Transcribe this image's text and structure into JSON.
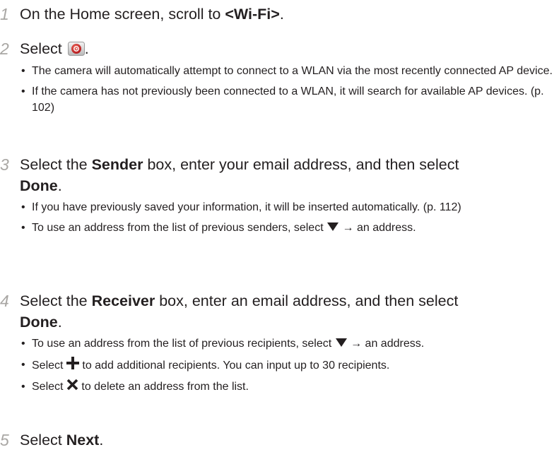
{
  "steps": [
    {
      "num": "1",
      "pre": "On the Home screen, scroll to ",
      "bold": "<Wi-Fi>",
      "post": "."
    },
    {
      "num": "2",
      "pre": "Select ",
      "icon": "email-app-icon",
      "post": ".",
      "bullets": [
        "The camera will automatically attempt to connect to a WLAN via the most recently connected AP device.",
        "If the camera has not previously been connected to a WLAN, it will search for available AP devices. (p. 102)"
      ]
    },
    {
      "num": "3",
      "pre": "Select the ",
      "bold": "Sender",
      "mid": " box, enter your email address, and then select",
      "bold2": "Done",
      "post": ".",
      "bullets": [
        "If you have previously saved your information, it will be inserted automatically. (p. 112)"
      ],
      "bullet_with_glyph": {
        "pre": "To use an address from the list of previous senders, select ",
        "glyph": "dropdown-triangle-icon",
        "post": " → an address."
      }
    },
    {
      "num": "4",
      "pre": "Select the ",
      "bold": "Receiver",
      "mid": " box, enter an email address, and then select",
      "bold2": "Done",
      "post": ".",
      "bullet_triangle": {
        "pre": "To use an address from the list of previous recipients, select ",
        "glyph": "dropdown-triangle-icon",
        "post": " → an address."
      },
      "bullet_plus": {
        "pre": "Select ",
        "glyph": "plus-icon",
        "post": " to add additional recipients. You can input up to 30 recipients."
      },
      "bullet_x": {
        "pre": "Select ",
        "glyph": "close-x-icon",
        "post": " to delete an address from the list."
      }
    },
    {
      "num": "5",
      "pre": "Select ",
      "bold": "Next",
      "post": "."
    }
  ],
  "bullet_char": "•",
  "colors": {
    "step_number": "#a9a7a4",
    "text": "#231f20",
    "icon_red": "#c8201e"
  }
}
